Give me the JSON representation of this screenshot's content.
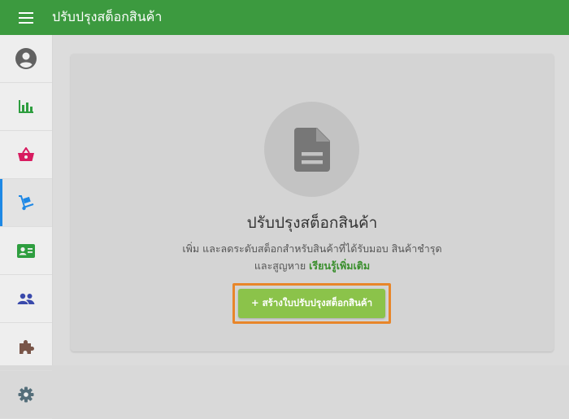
{
  "topbar": {
    "title": "ปรับปรุงสต็อกสินค้า",
    "menu_icon": "hamburger-menu-icon",
    "background": "#3c9a3f"
  },
  "sidebar": {
    "items": [
      {
        "icon": "account-circle-icon",
        "color": "#616161",
        "active": false
      },
      {
        "icon": "bar-chart-icon",
        "color": "#2e9e3f",
        "active": false
      },
      {
        "icon": "shopping-basket-icon",
        "color": "#d81b60",
        "active": false
      },
      {
        "icon": "hand-truck-icon",
        "color": "#1e88e5",
        "active": true
      },
      {
        "icon": "contact-card-icon",
        "color": "#2e9e3f",
        "active": false
      },
      {
        "icon": "people-icon",
        "color": "#3949ab",
        "active": false
      },
      {
        "icon": "puzzle-piece-icon",
        "color": "#795548",
        "active": false
      },
      {
        "icon": "settings-gear-icon",
        "color": "#546e7a",
        "active": false
      }
    ]
  },
  "empty_state": {
    "icon": "document-icon",
    "title": "ปรับปรุงสต็อกสินค้า",
    "description_line1": "เพิ่ม และลดระดับสต็อกสำหรับสินค้าที่ได้รับมอบ สินค้าชำรุด",
    "description_line2_prefix": "และสูญหาย",
    "learn_more": "เรียนรู้เพิ่มเติม",
    "create_button": "+ สร้างใบปรับปรุงสต็อกสินค้า",
    "accent": "#8bc34a",
    "highlight": "#e8862a"
  }
}
